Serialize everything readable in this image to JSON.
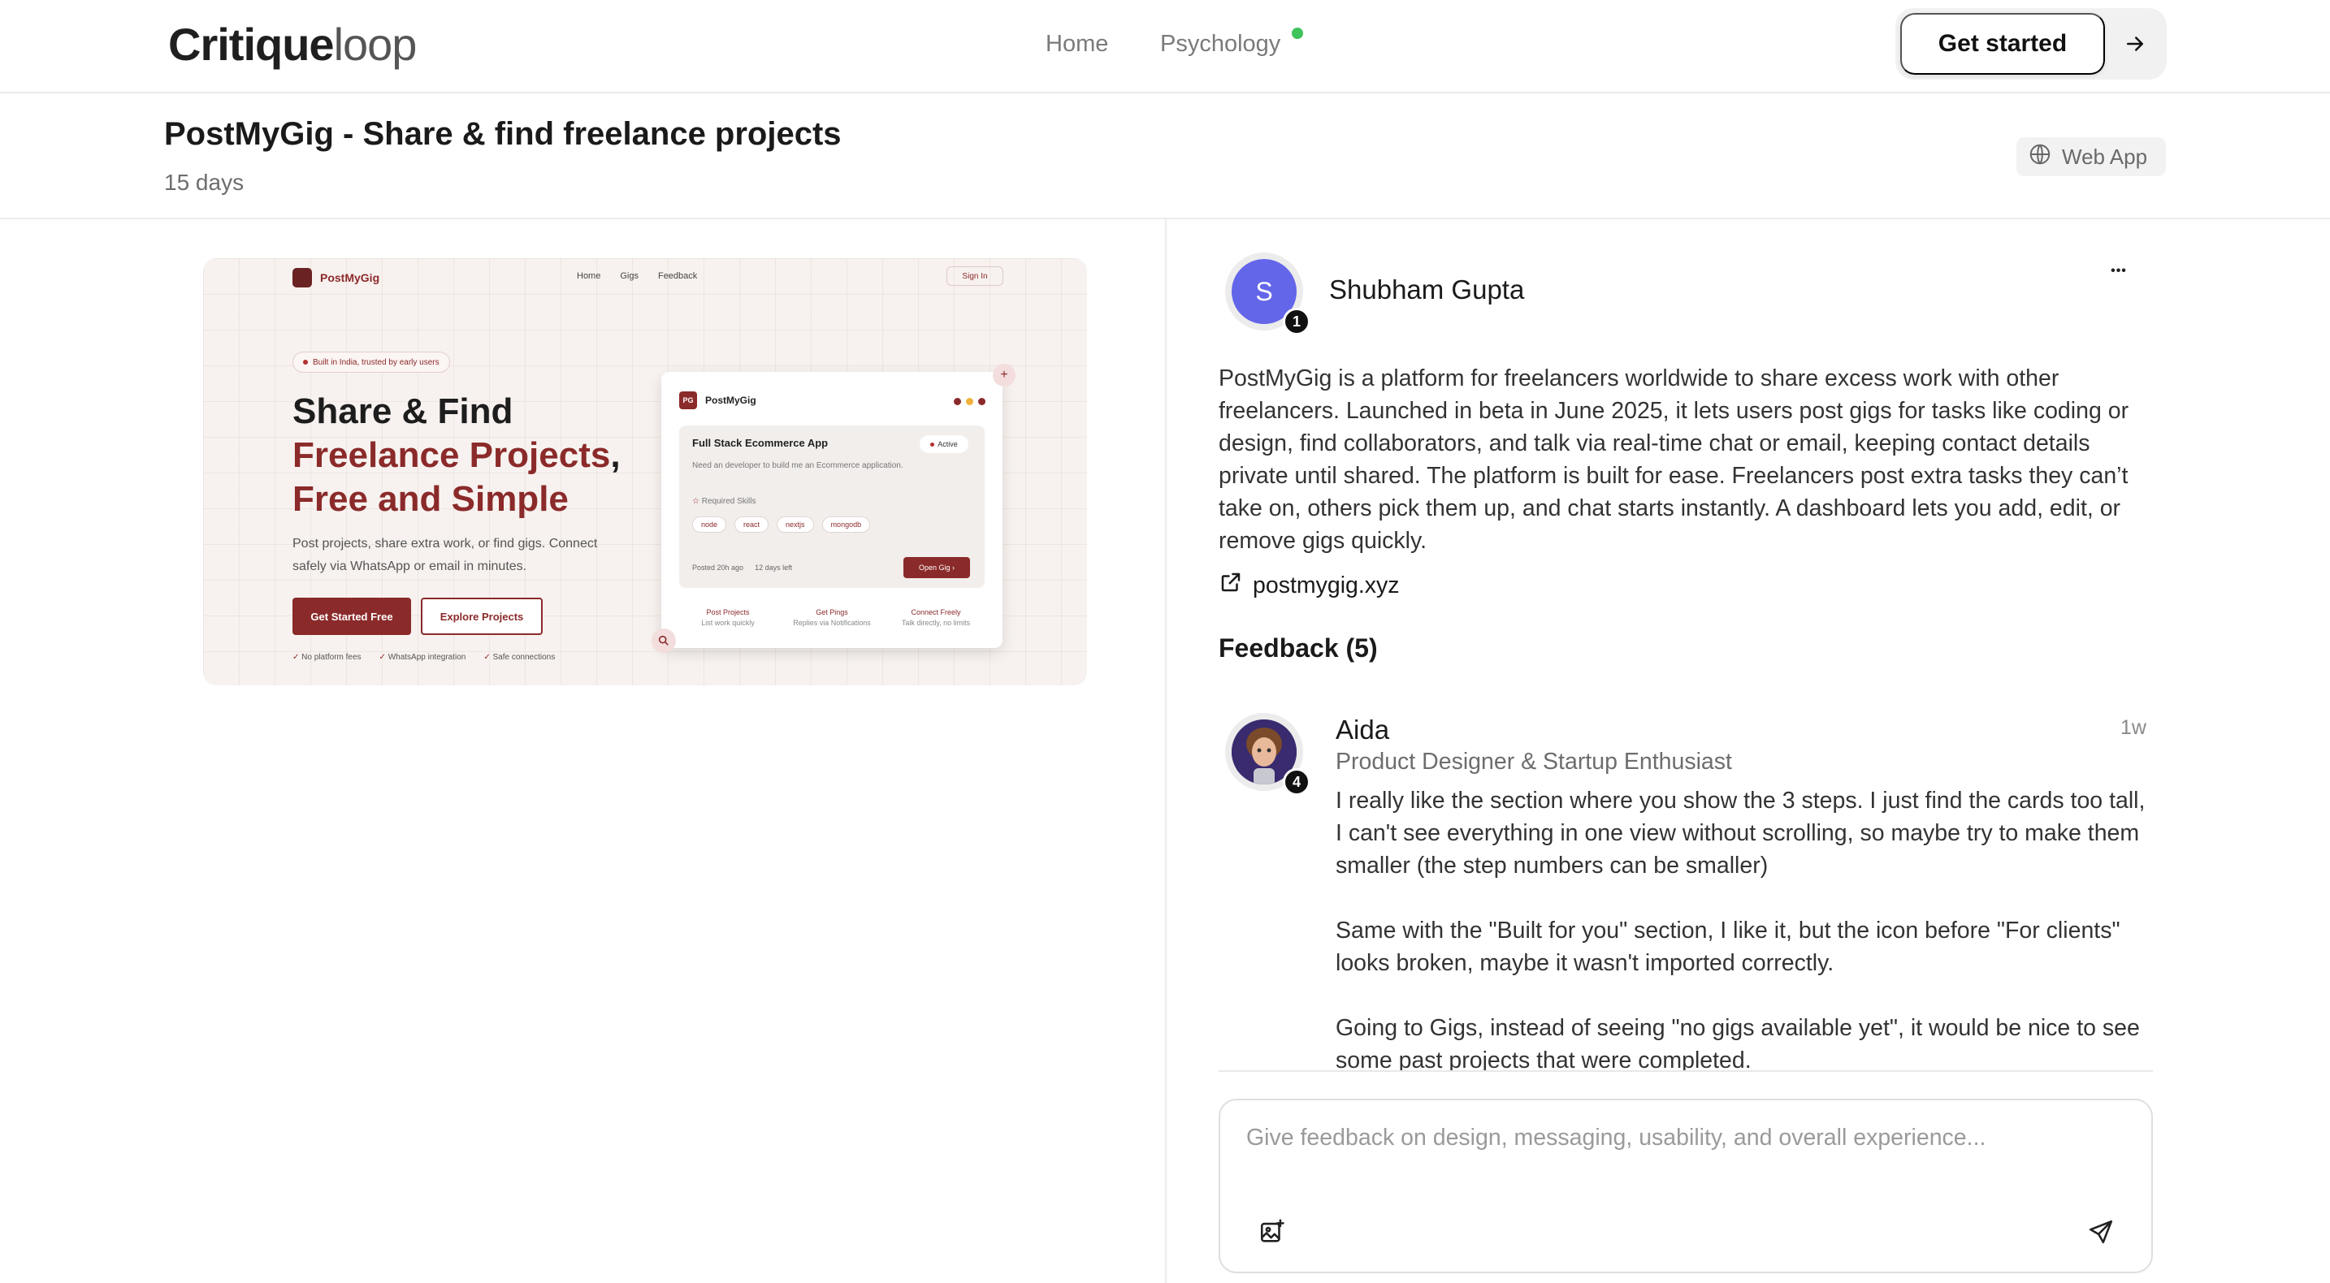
{
  "header": {
    "logo_main": "Critique",
    "logo_accent": "loop",
    "nav": [
      {
        "label": "Home"
      },
      {
        "label": "Psychology"
      }
    ],
    "cta_label": "Get started"
  },
  "project": {
    "title": "PostMyGig - Share & find freelance projects",
    "age": "15 days",
    "platform_badge": "Web App"
  },
  "preview": {
    "brand": "PostMyGig",
    "nav": [
      "Home",
      "Gigs",
      "Feedback"
    ],
    "sign_in": "Sign In",
    "tag": "Built in India, trusted by early users",
    "headline_line1": "Share & Find",
    "headline_line2": "Freelance Projects",
    "headline_comma": ",",
    "headline_line3": "Free and Simple",
    "description": "Post projects, share extra work, or find gigs. Connect safely via WhatsApp or email in minutes.",
    "primary_button": "Get Started Free",
    "secondary_button": "Explore Projects",
    "checks": [
      "No platform fees",
      "WhatsApp integration",
      "Safe connections"
    ],
    "card": {
      "brand_short": "PG",
      "brand": "PostMyGig",
      "gig_title": "Full Stack Ecommerce App",
      "status": "Active",
      "gig_desc": "Need an developer to build me an Ecommerce application.",
      "required_label": "Required Skills",
      "skills": [
        "node",
        "react",
        "nextjs",
        "mongodb"
      ],
      "posted": "Posted 20h ago",
      "days_left": "12 days left",
      "open_button": "Open Gig",
      "steps": [
        {
          "title": "Post Projects",
          "sub": "List work quickly"
        },
        {
          "title": "Get Pings",
          "sub": "Replies via Notifications"
        },
        {
          "title": "Connect Freely",
          "sub": "Talk directly, no limits"
        }
      ]
    }
  },
  "post": {
    "author_initial": "S",
    "author_level": "1",
    "author_name": "Shubham Gupta",
    "more_label": "•••",
    "description": "PostMyGig is a platform for freelancers worldwide to share excess work with other freelancers.   Launched in beta in June 2025, it lets users post gigs for tasks like coding or design, find collaborators, and talk via real-time chat or email, keeping contact details private until shared.  The platform is built for ease. Freelancers post extra tasks they can’t take on, others pick them up, and chat starts instantly. A dashboard lets you add, edit, or remove gigs quickly.",
    "link": "postmygig.xyz"
  },
  "feedback": {
    "title": "Feedback (5)",
    "comments": [
      {
        "name": "Aida",
        "level": "4",
        "time": "1w",
        "role": "Product Designer & Startup Enthusiast",
        "paragraphs": [
          "I really like the section where you show the 3 steps. I just find the cards too tall, I can't see everything in one view without scrolling, so maybe try to make them smaller (the step numbers can be smaller)",
          "Same with the \"Built for you\" section, I like it, but the icon before \"For clients\" looks broken, maybe it wasn't imported correctly.",
          "Going to Gigs, instead of seeing \"no gigs available yet\", it would be nice to see some past projects that were completed."
        ]
      }
    ],
    "composer_placeholder": "Give feedback on design, messaging, usability, and overall experience..."
  },
  "colors": {
    "accent_purple": "#6366e9",
    "brand_red": "#8b2a2a",
    "status_green": "#3fc35b"
  }
}
